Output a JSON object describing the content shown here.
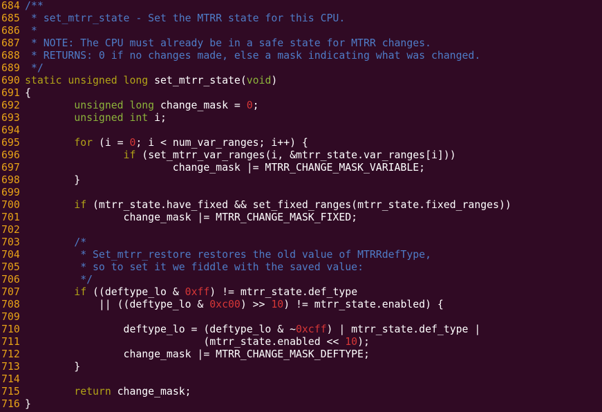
{
  "editor": {
    "colors": {
      "background": "#300a24",
      "line_number": "#e8a317",
      "comment": "#4f7cc7",
      "keyword": "#b2a417",
      "type": "#8cb33b",
      "number": "#d73737",
      "plain": "#ffffff"
    },
    "lines": [
      {
        "n": "684",
        "tokens": [
          {
            "t": "comment",
            "s": "/**"
          }
        ]
      },
      {
        "n": "685",
        "tokens": [
          {
            "t": "comment",
            "s": " * set_mtrr_state - Set the MTRR state for this CPU."
          }
        ]
      },
      {
        "n": "686",
        "tokens": [
          {
            "t": "comment",
            "s": " *"
          }
        ]
      },
      {
        "n": "687",
        "tokens": [
          {
            "t": "comment",
            "s": " * NOTE: The CPU must already be in a safe state for MTRR changes."
          }
        ]
      },
      {
        "n": "688",
        "tokens": [
          {
            "t": "comment",
            "s": " * RETURNS: 0 if no changes made, else a mask indicating what was changed."
          }
        ]
      },
      {
        "n": "689",
        "tokens": [
          {
            "t": "comment",
            "s": " */"
          }
        ]
      },
      {
        "n": "690",
        "tokens": [
          {
            "t": "keyword",
            "s": "static"
          },
          {
            "t": "plain",
            "s": " "
          },
          {
            "t": "keyword",
            "s": "unsigned long"
          },
          {
            "t": "plain",
            "s": " set_mtrr_state("
          },
          {
            "t": "type",
            "s": "void"
          },
          {
            "t": "plain",
            "s": ")"
          }
        ]
      },
      {
        "n": "691",
        "tokens": [
          {
            "t": "plain",
            "s": "{"
          }
        ]
      },
      {
        "n": "692",
        "tokens": [
          {
            "t": "plain",
            "s": "        "
          },
          {
            "t": "type",
            "s": "unsigned long"
          },
          {
            "t": "plain",
            "s": " change_mask = "
          },
          {
            "t": "number",
            "s": "0"
          },
          {
            "t": "plain",
            "s": ";"
          }
        ]
      },
      {
        "n": "693",
        "tokens": [
          {
            "t": "plain",
            "s": "        "
          },
          {
            "t": "type",
            "s": "unsigned int"
          },
          {
            "t": "plain",
            "s": " i;"
          }
        ]
      },
      {
        "n": "694",
        "tokens": []
      },
      {
        "n": "695",
        "tokens": [
          {
            "t": "plain",
            "s": "        "
          },
          {
            "t": "keyword",
            "s": "for"
          },
          {
            "t": "plain",
            "s": " (i = "
          },
          {
            "t": "number",
            "s": "0"
          },
          {
            "t": "plain",
            "s": "; i < num_var_ranges; i++) {"
          }
        ]
      },
      {
        "n": "696",
        "tokens": [
          {
            "t": "plain",
            "s": "                "
          },
          {
            "t": "keyword",
            "s": "if"
          },
          {
            "t": "plain",
            "s": " (set_mtrr_var_ranges(i, &mtrr_state.var_ranges[i]))"
          }
        ]
      },
      {
        "n": "697",
        "tokens": [
          {
            "t": "plain",
            "s": "                        change_mask |= MTRR_CHANGE_MASK_VARIABLE;"
          }
        ]
      },
      {
        "n": "698",
        "tokens": [
          {
            "t": "plain",
            "s": "        }"
          }
        ]
      },
      {
        "n": "699",
        "tokens": []
      },
      {
        "n": "700",
        "tokens": [
          {
            "t": "plain",
            "s": "        "
          },
          {
            "t": "keyword",
            "s": "if"
          },
          {
            "t": "plain",
            "s": " (mtrr_state.have_fixed && set_fixed_ranges(mtrr_state.fixed_ranges))"
          }
        ]
      },
      {
        "n": "701",
        "tokens": [
          {
            "t": "plain",
            "s": "                change_mask |= MTRR_CHANGE_MASK_FIXED;"
          }
        ]
      },
      {
        "n": "702",
        "tokens": []
      },
      {
        "n": "703",
        "tokens": [
          {
            "t": "plain",
            "s": "        "
          },
          {
            "t": "comment",
            "s": "/*"
          }
        ]
      },
      {
        "n": "704",
        "tokens": [
          {
            "t": "plain",
            "s": "        "
          },
          {
            "t": "comment",
            "s": " * Set_mtrr_restore restores the old value of MTRRdefType,"
          }
        ]
      },
      {
        "n": "705",
        "tokens": [
          {
            "t": "plain",
            "s": "        "
          },
          {
            "t": "comment",
            "s": " * so to set it we fiddle with the saved value:"
          }
        ]
      },
      {
        "n": "706",
        "tokens": [
          {
            "t": "plain",
            "s": "        "
          },
          {
            "t": "comment",
            "s": " */"
          }
        ]
      },
      {
        "n": "707",
        "tokens": [
          {
            "t": "plain",
            "s": "        "
          },
          {
            "t": "keyword",
            "s": "if"
          },
          {
            "t": "plain",
            "s": " ((deftype_lo & "
          },
          {
            "t": "number",
            "s": "0xff"
          },
          {
            "t": "plain",
            "s": ") != mtrr_state.def_type"
          }
        ]
      },
      {
        "n": "708",
        "tokens": [
          {
            "t": "plain",
            "s": "            || ((deftype_lo & "
          },
          {
            "t": "number",
            "s": "0xc00"
          },
          {
            "t": "plain",
            "s": ") >> "
          },
          {
            "t": "number",
            "s": "10"
          },
          {
            "t": "plain",
            "s": ") != mtrr_state.enabled) {"
          }
        ]
      },
      {
        "n": "709",
        "tokens": []
      },
      {
        "n": "710",
        "tokens": [
          {
            "t": "plain",
            "s": "                deftype_lo = (deftype_lo & ~"
          },
          {
            "t": "number",
            "s": "0xcff"
          },
          {
            "t": "plain",
            "s": ") | mtrr_state.def_type |"
          }
        ]
      },
      {
        "n": "711",
        "tokens": [
          {
            "t": "plain",
            "s": "                             (mtrr_state.enabled << "
          },
          {
            "t": "number",
            "s": "10"
          },
          {
            "t": "plain",
            "s": ");"
          }
        ]
      },
      {
        "n": "712",
        "tokens": [
          {
            "t": "plain",
            "s": "                change_mask |= MTRR_CHANGE_MASK_DEFTYPE;"
          }
        ]
      },
      {
        "n": "713",
        "tokens": [
          {
            "t": "plain",
            "s": "        }"
          }
        ]
      },
      {
        "n": "714",
        "tokens": []
      },
      {
        "n": "715",
        "tokens": [
          {
            "t": "plain",
            "s": "        "
          },
          {
            "t": "keyword",
            "s": "return"
          },
          {
            "t": "plain",
            "s": " change_mask;"
          }
        ]
      },
      {
        "n": "716",
        "tokens": [
          {
            "t": "plain",
            "s": "}"
          }
        ]
      }
    ]
  }
}
